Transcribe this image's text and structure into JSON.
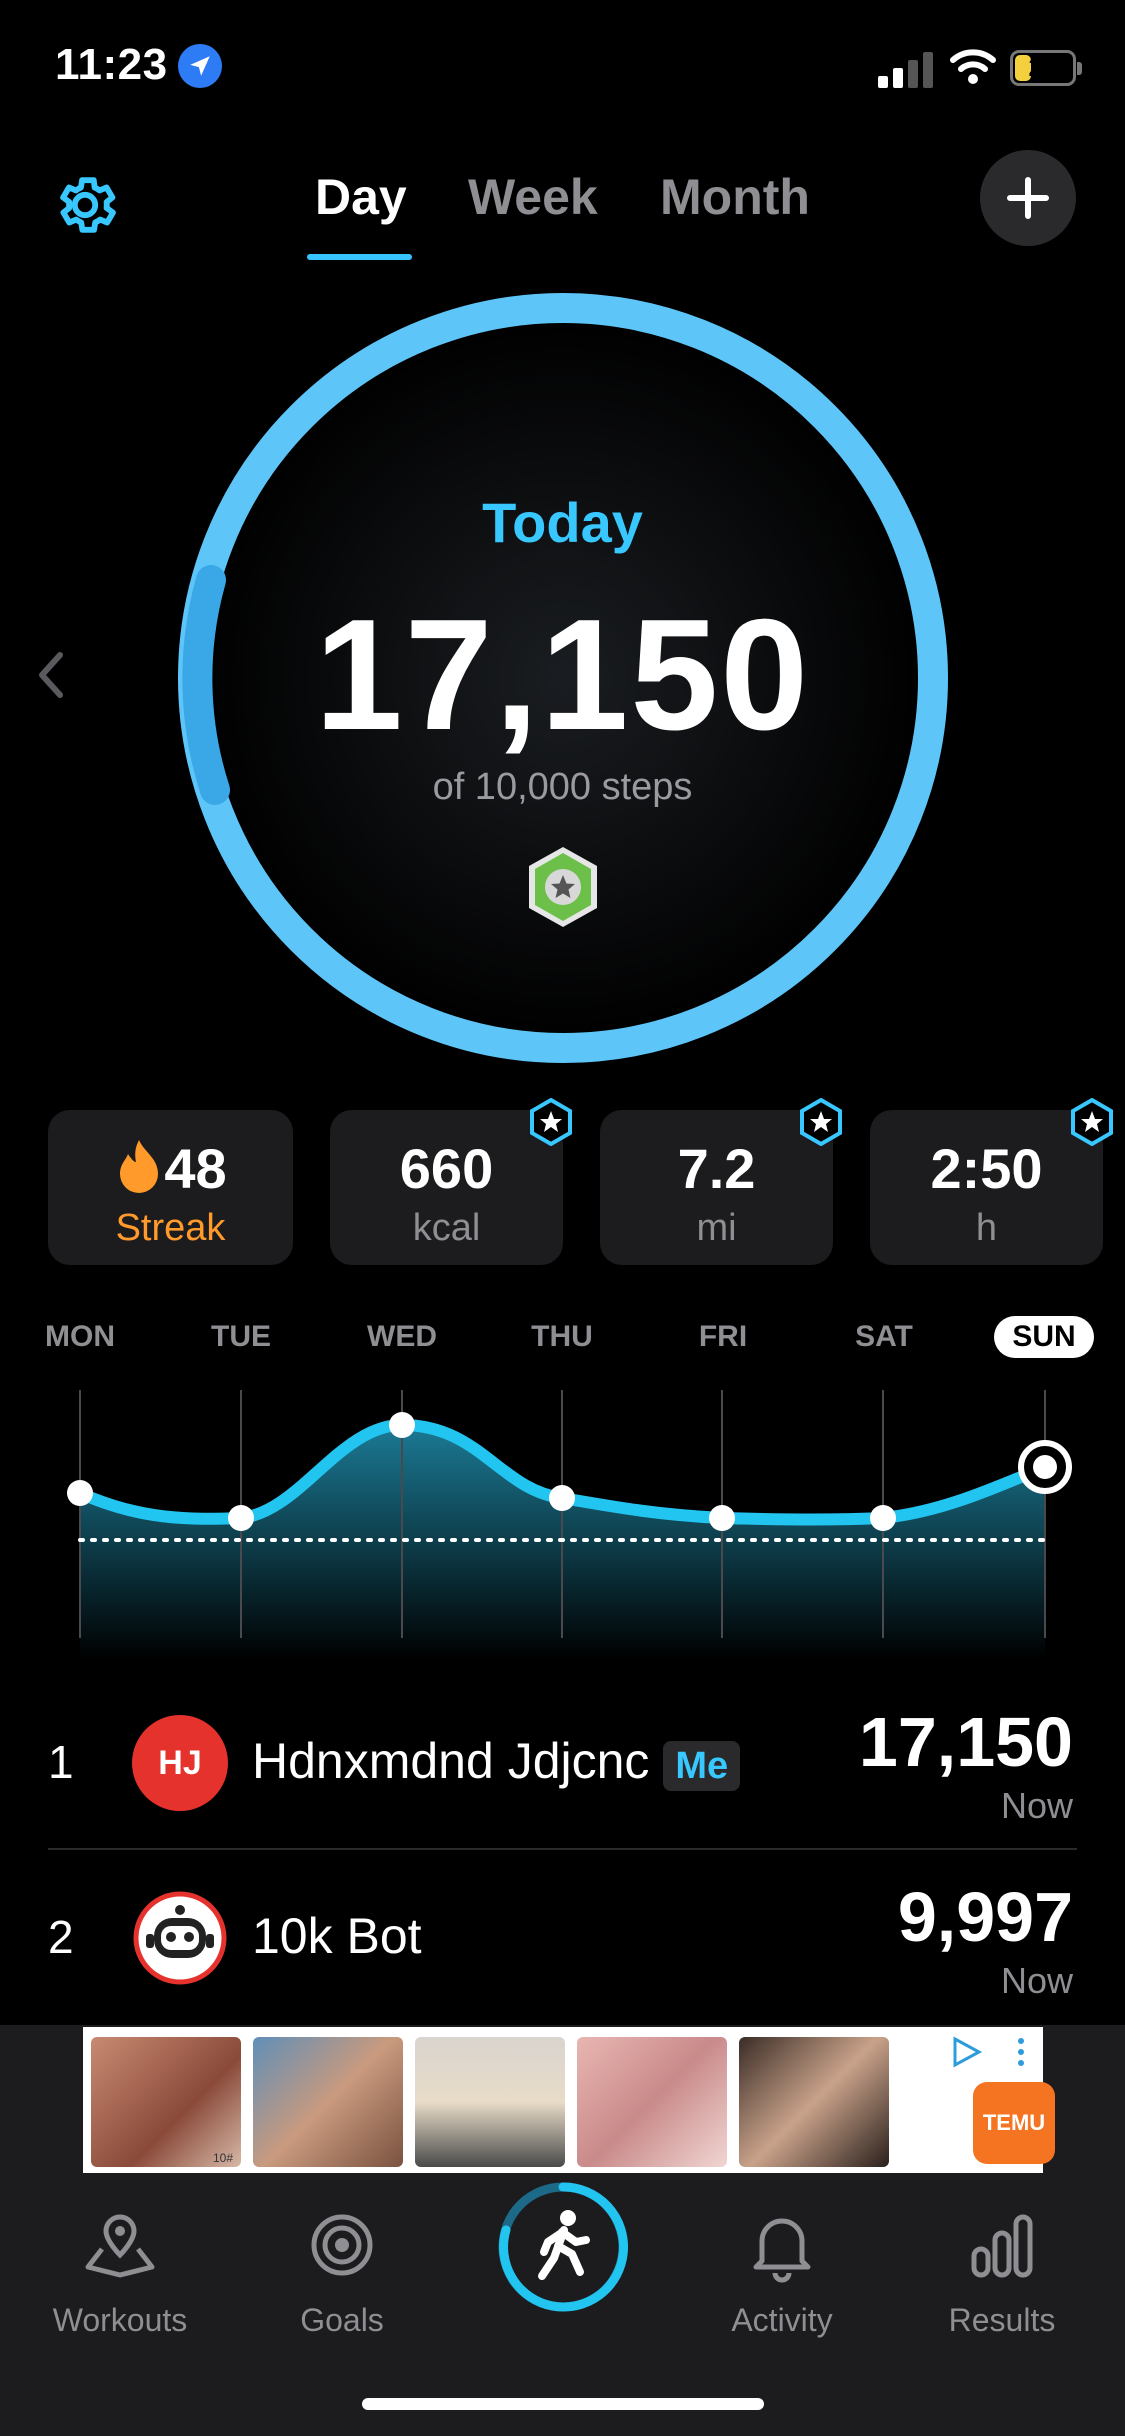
{
  "status_bar": {
    "time": "11:23",
    "battery": "21"
  },
  "header": {
    "tabs": [
      {
        "label": "Day",
        "active": true
      },
      {
        "label": "Week",
        "active": false
      },
      {
        "label": "Month",
        "active": false
      }
    ]
  },
  "ring": {
    "label": "Today",
    "steps": "17,150",
    "goal_text": "of 10,000 steps",
    "progress_fraction": 1.0,
    "accent": "#5ec5f8"
  },
  "stats": [
    {
      "value": "48",
      "label": "Streak",
      "icon": "flame-icon"
    },
    {
      "value": "660",
      "label": "kcal"
    },
    {
      "value": "7.2",
      "label": "mi"
    },
    {
      "value": "2:50",
      "label": "h"
    }
  ],
  "week": {
    "days": [
      "MON",
      "TUE",
      "WED",
      "THU",
      "FRI",
      "SAT",
      "SUN"
    ],
    "active_day": "SUN"
  },
  "leaderboard": [
    {
      "rank": "1",
      "initials": "HJ",
      "name": "Hdnxmdnd Jdjcnc",
      "tag": "Me",
      "score": "17,150",
      "when": "Now"
    },
    {
      "rank": "2",
      "name": "10k Bot",
      "score": "9,997",
      "when": "Now"
    }
  ],
  "ad": {
    "brand": "TEMU",
    "thumb_label": "10#"
  },
  "tabbar": {
    "items": [
      {
        "label": "Workouts",
        "icon": "map-pin-icon"
      },
      {
        "label": "Goals",
        "icon": "target-icon"
      },
      {
        "label": "Activity",
        "icon": "bell-icon"
      },
      {
        "label": "Results",
        "icon": "bar-chart-icon"
      }
    ]
  }
}
